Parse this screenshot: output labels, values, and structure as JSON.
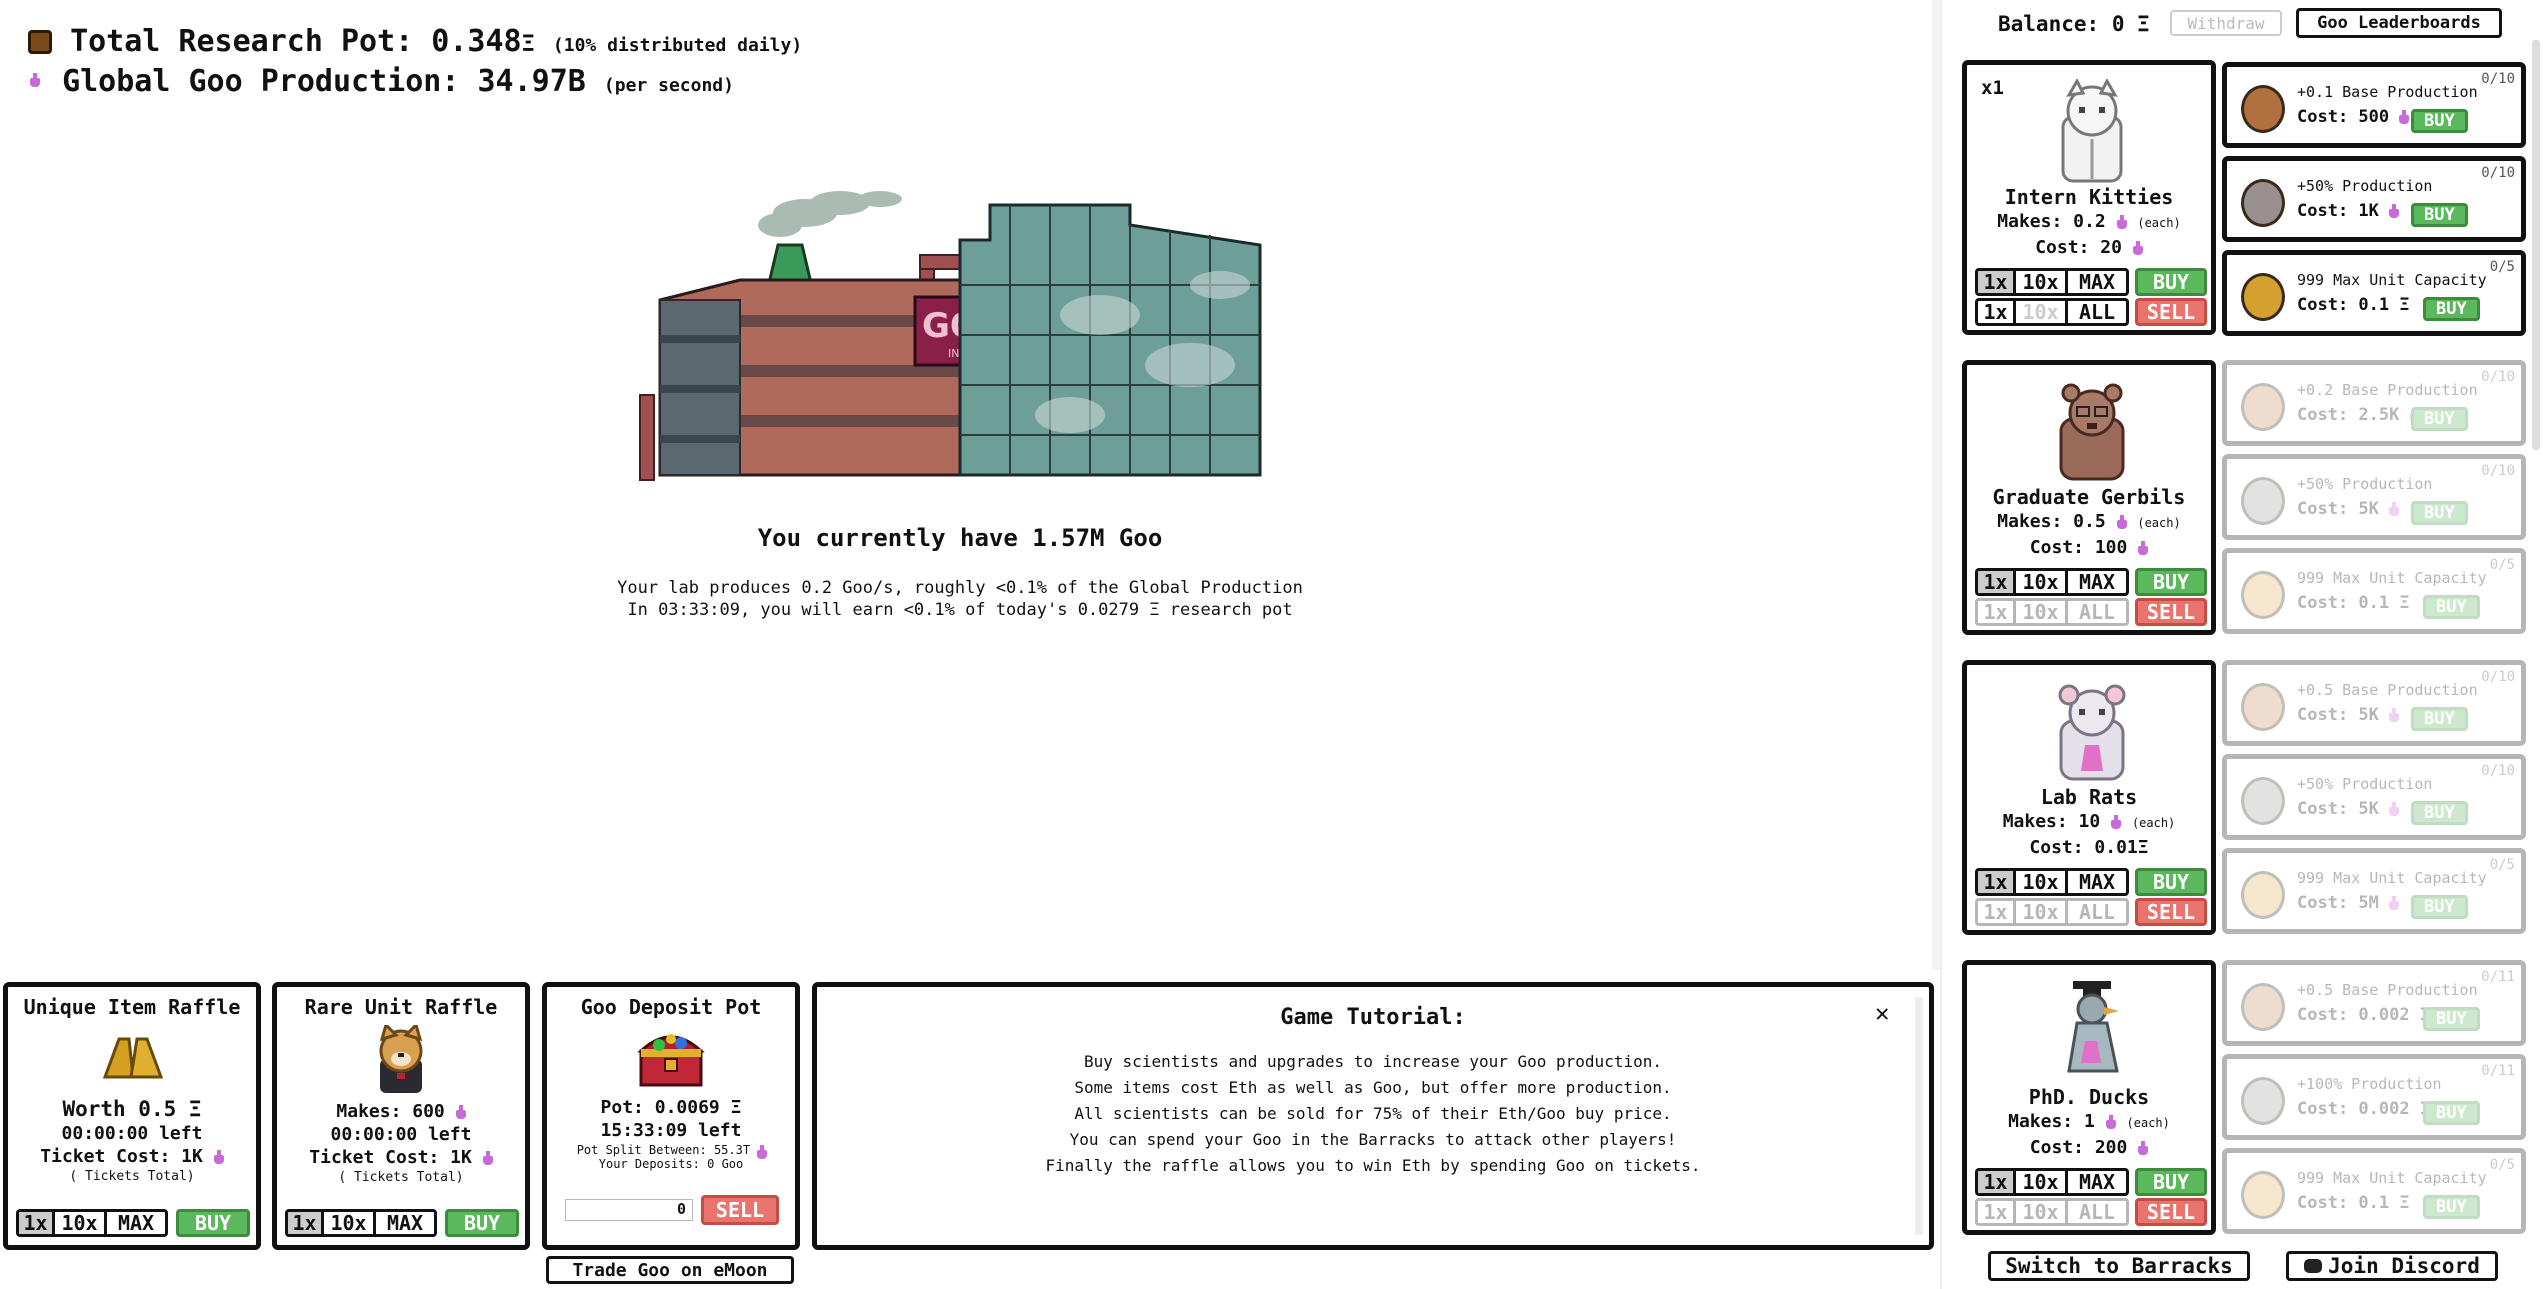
{
  "header": {
    "pot_label": "Total Research Pot:",
    "pot_value": "0.348",
    "pot_unit": "Ξ",
    "pot_note": "(10% distributed daily)",
    "prod_label": "Global Goo Production:",
    "prod_value": "34.97B",
    "prod_note": "(per second)"
  },
  "factory": {
    "sign": "GOO",
    "sign_sub": "INC."
  },
  "status": {
    "have": "You currently have 1.57M Goo",
    "line1": "Your lab produces 0.2 Goo/s, roughly <0.1% of the Global Production",
    "line2": "In 03:33:09, you will earn <0.1% of today's 0.0279 Ξ research pot"
  },
  "topbar": {
    "balance_label": "Balance:",
    "balance_value": "0 Ξ",
    "withdraw": "Withdraw",
    "leaderboards": "Goo Leaderboards"
  },
  "units": [
    {
      "count": "x1",
      "name": "Intern Kitties",
      "makes": "Makes: 0.2",
      "each": "(each)",
      "cost": "Cost: 20",
      "cost_unit": "flask"
    },
    {
      "count": "",
      "name": "Graduate Gerbils",
      "makes": "Makes: 0.5",
      "each": "(each)",
      "cost": "Cost: 100",
      "cost_unit": "flask"
    },
    {
      "count": "",
      "name": "Lab Rats",
      "makes": "Makes: 10",
      "each": "(each)",
      "cost": "Cost: 0.01Ξ",
      "cost_unit": "eth"
    },
    {
      "count": "",
      "name": "PhD. Ducks",
      "makes": "Makes: 1",
      "each": "(each)",
      "cost": "Cost: 200",
      "cost_unit": "flask"
    }
  ],
  "unit_buttons": {
    "q1": "1x",
    "q10": "10x",
    "qmax": "MAX",
    "buy": "BUY",
    "s1": "1x",
    "s10": "10x",
    "sall": "ALL",
    "sell": "SELL"
  },
  "upgrades": [
    {
      "title": "+0.1 Base Production",
      "cost": "Cost: 500",
      "count": "0/10",
      "color": "#b07040",
      "dim": false
    },
    {
      "title": "+50% Production",
      "cost": "Cost: 1K",
      "count": "0/10",
      "color": "#9a9090",
      "dim": false
    },
    {
      "title": "999 Max Unit Capacity",
      "cost": "Cost: 0.1 Ξ",
      "count": "0/5",
      "color": "#d4a030",
      "dim": false
    },
    {
      "title": "+0.2 Base Production",
      "cost": "Cost: 2.5K",
      "count": "0/10",
      "color": "#c89060",
      "dim": true
    },
    {
      "title": "+50% Production",
      "cost": "Cost: 5K",
      "count": "0/10",
      "color": "#a0a0a0",
      "dim": true
    },
    {
      "title": "999 Max Unit Capacity",
      "cost": "Cost: 0.1 Ξ",
      "count": "0/5",
      "color": "#e0b060",
      "dim": true
    },
    {
      "title": "+0.5 Base Production",
      "cost": "Cost: 5K",
      "count": "0/10",
      "color": "#c89060",
      "dim": true
    },
    {
      "title": "+50% Production",
      "cost": "Cost: 5K",
      "count": "0/10",
      "color": "#a0a0a0",
      "dim": true
    },
    {
      "title": "999 Max Unit Capacity",
      "cost": "Cost: 5M",
      "count": "0/5",
      "color": "#e0b060",
      "dim": true
    },
    {
      "title": "+0.5 Base Production",
      "cost": "Cost: 0.002 Ξ",
      "count": "0/11",
      "color": "#c89060",
      "dim": true
    },
    {
      "title": "+100% Production",
      "cost": "Cost: 0.002 Ξ",
      "count": "0/11",
      "color": "#a0a0a0",
      "dim": true
    },
    {
      "title": "999 Max Unit Capacity",
      "cost": "Cost: 0.1 Ξ",
      "count": "0/5",
      "color": "#e0b060",
      "dim": true
    }
  ],
  "upgrade_buy": "BUY",
  "raffles": {
    "unique": {
      "title": "Unique Item Raffle",
      "worth": "Worth 0.5 Ξ",
      "left": "00:00:00 left",
      "ticket": "Ticket Cost: 1K",
      "total": "( Tickets Total)"
    },
    "rare": {
      "title": "Rare Unit Raffle",
      "makes": "Makes: 600",
      "left": "00:00:00 left",
      "ticket": "Ticket Cost: 1K",
      "total": "( Tickets Total)"
    },
    "buttons": {
      "q1": "1x",
      "q10": "10x",
      "qmax": "MAX",
      "buy": "BUY"
    }
  },
  "deposit": {
    "title": "Goo Deposit Pot",
    "pot": "Pot: 0.0069 Ξ",
    "time": "15:33:09 left",
    "split": "Pot Split Between: 55.3T",
    "yours": "Your Deposits: 0 Goo",
    "input_value": "0",
    "sell": "SELL",
    "trade": "Trade Goo on eMoon"
  },
  "tutorial": {
    "title": "Game Tutorial:",
    "close": "✕",
    "lines": [
      "Buy scientists and upgrades to increase your Goo production.",
      "Some items cost Eth as well as Goo, but offer more production.",
      "All scientists can be sold for 75% of their Eth/Goo buy price.",
      "You can spend your Goo in the Barracks to attack other players!",
      "Finally the raffle allows you to win Eth by spending Goo on tickets."
    ]
  },
  "footer": {
    "barracks": "Switch to Barracks",
    "discord": "Join Discord"
  },
  "icons": {
    "chest": "treasure-chest-icon",
    "flask": "flask-icon",
    "eth": "eth-icon",
    "discord": "discord-icon"
  }
}
